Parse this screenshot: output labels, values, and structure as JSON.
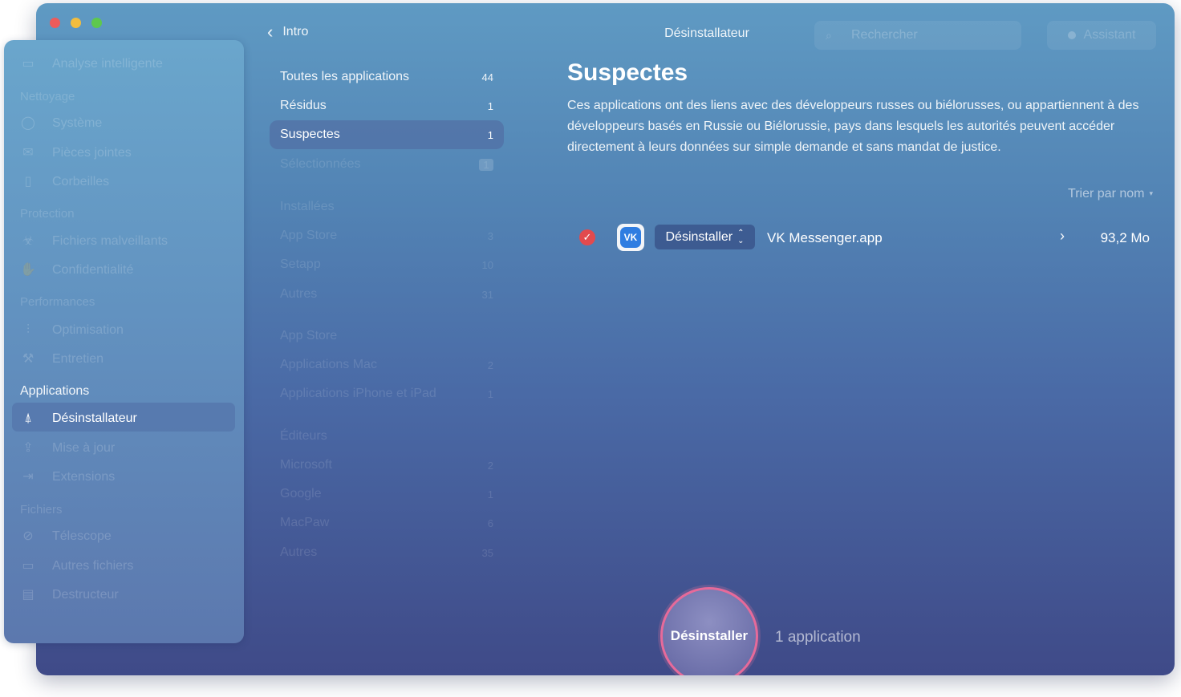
{
  "window": {
    "title": "Désinstallateur",
    "back_label": "Intro"
  },
  "search": {
    "placeholder": "Rechercher"
  },
  "assistant": {
    "label": "Assistant"
  },
  "sidebar": {
    "items": [
      {
        "type": "item",
        "icon": "monitor-icon",
        "label": "Analyse intelligente"
      },
      {
        "type": "section",
        "label": "Nettoyage"
      },
      {
        "type": "item",
        "icon": "disk-icon",
        "label": "Système"
      },
      {
        "type": "item",
        "icon": "mail-icon",
        "label": "Pièces jointes"
      },
      {
        "type": "item",
        "icon": "trash-icon",
        "label": "Corbeilles"
      },
      {
        "type": "section",
        "label": "Protection"
      },
      {
        "type": "item",
        "icon": "biohazard-icon",
        "label": "Fichiers malveillants"
      },
      {
        "type": "item",
        "icon": "hand-icon",
        "label": "Confidentialité"
      },
      {
        "type": "section",
        "label": "Performances"
      },
      {
        "type": "item",
        "icon": "sliders-icon",
        "label": "Optimisation"
      },
      {
        "type": "item",
        "icon": "wrench-icon",
        "label": "Entretien"
      },
      {
        "type": "section",
        "label": "Applications"
      },
      {
        "type": "item",
        "icon": "app-store-icon",
        "label": "Désinstallateur"
      },
      {
        "type": "item",
        "icon": "update-icon",
        "label": "Mise à jour"
      },
      {
        "type": "item",
        "icon": "extensions-icon",
        "label": "Extensions"
      },
      {
        "type": "section",
        "label": "Fichiers"
      },
      {
        "type": "item",
        "icon": "telescope-icon",
        "label": "Télescope"
      },
      {
        "type": "item",
        "icon": "folder-icon",
        "label": "Autres fichiers"
      },
      {
        "type": "item",
        "icon": "shredder-icon",
        "label": "Destructeur"
      }
    ]
  },
  "list": {
    "rows": [
      {
        "label": "Toutes les applications",
        "count": "44"
      },
      {
        "label": "Résidus",
        "count": "1"
      },
      {
        "label": "Suspectes",
        "count": "1"
      },
      {
        "label": "Sélectionnées",
        "count": "1"
      },
      {
        "label": "Installées",
        "count": ""
      },
      {
        "label": "App Store",
        "count": "3"
      },
      {
        "label": "Setapp",
        "count": "10"
      },
      {
        "label": "Autres",
        "count": "31"
      },
      {
        "label": "App Store",
        "count": ""
      },
      {
        "label": "Applications Mac",
        "count": "2"
      },
      {
        "label": "Applications iPhone et iPad",
        "count": "1"
      },
      {
        "label": "Éditeurs",
        "count": ""
      },
      {
        "label": "Microsoft",
        "count": "2"
      },
      {
        "label": "Google",
        "count": "1"
      },
      {
        "label": "MacPaw",
        "count": "6"
      },
      {
        "label": "Autres",
        "count": "35"
      }
    ]
  },
  "content": {
    "heading": "Suspectes",
    "description": "Ces applications ont des liens avec des développeurs russes ou biélorusses, ou appartiennent à des développeurs basés en Russie ou Biélorussie, pays dans lesquels les autorités peuvent accéder directement à leurs données sur simple demande et sans mandat de justice.",
    "sort_label": "Trier par nom",
    "apps": [
      {
        "checked": true,
        "icon": "vk-app-icon",
        "icon_text": "VK",
        "action": "Désinstaller",
        "name": "VK Messenger.app",
        "size": "93,2 Mo"
      }
    ]
  },
  "footer": {
    "button_label": "Désinstaller",
    "count_label": "1 application"
  },
  "colors": {
    "accent_ring": "#e66a9a",
    "check_red": "#e24a4e",
    "vk_blue": "#2f7de1"
  }
}
